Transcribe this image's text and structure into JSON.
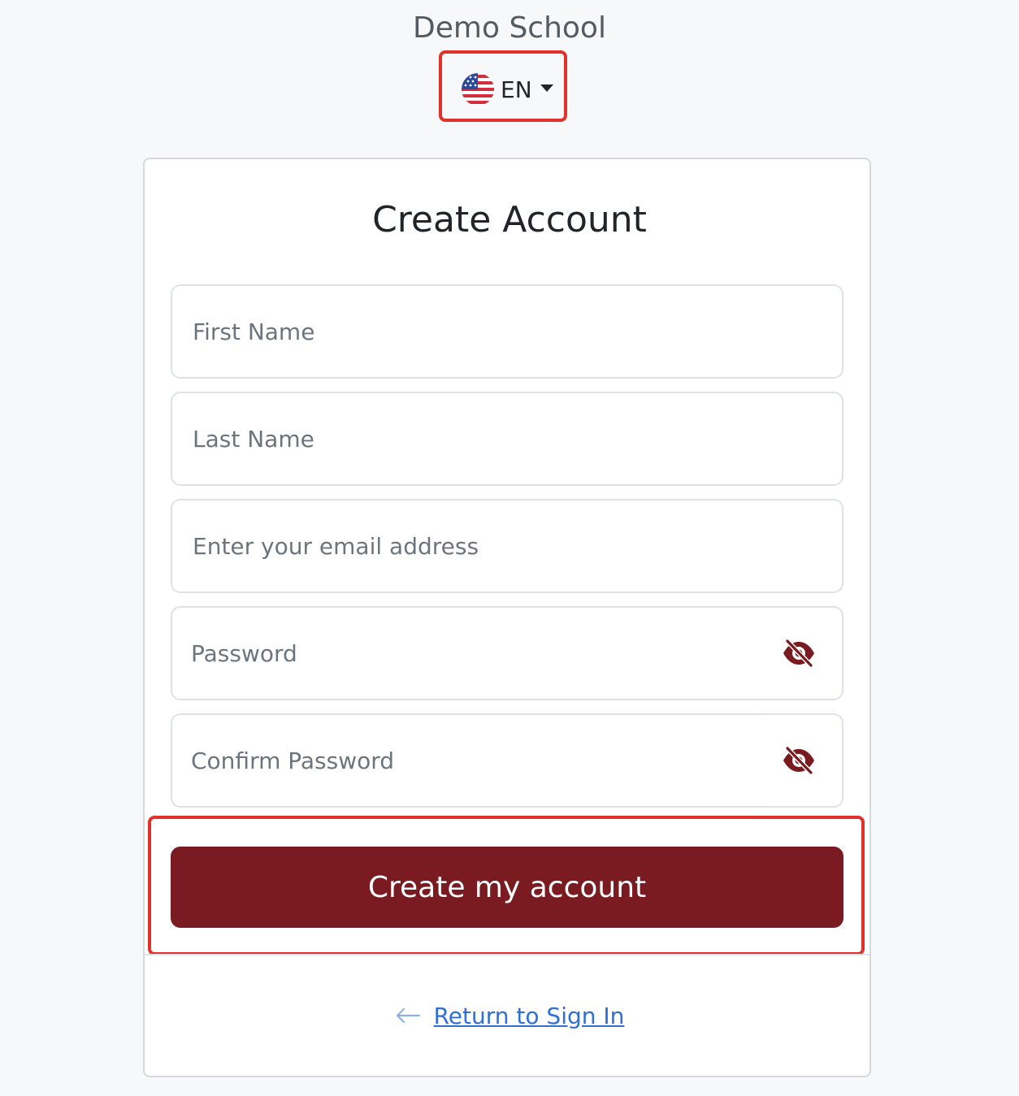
{
  "header": {
    "school_name": "Demo School"
  },
  "language": {
    "code": "EN",
    "flag_icon": "us-flag-icon"
  },
  "form": {
    "title": "Create Account",
    "fields": [
      {
        "name": "first-name",
        "placeholder": "First Name"
      },
      {
        "name": "last-name",
        "placeholder": "Last Name"
      },
      {
        "name": "email",
        "placeholder": "Enter your email address"
      },
      {
        "name": "password",
        "placeholder": "Password",
        "toggle_icon": "eye-slash-icon"
      },
      {
        "name": "confirm-password",
        "placeholder": "Confirm Password",
        "toggle_icon": "eye-slash-icon"
      }
    ],
    "submit_label": "Create my account"
  },
  "footer": {
    "return_icon": "arrow-left-icon",
    "return_label": "Return to Sign In"
  },
  "colors": {
    "brand": "#7a1a21",
    "link": "#2f6fd6",
    "highlight": "#e2312a",
    "background": "#f7f8f9"
  }
}
